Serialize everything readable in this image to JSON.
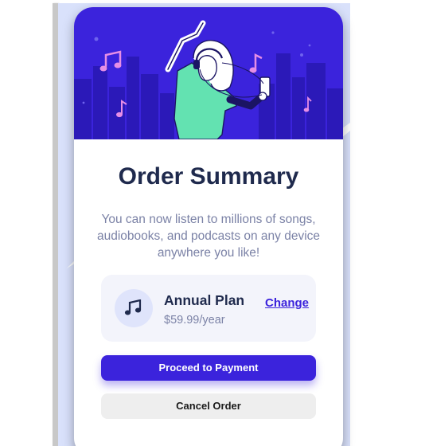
{
  "colors": {
    "accent": "#3b23dc",
    "title": "#1f2a4d",
    "muted": "#7b82a6",
    "plan_bg": "#f3f4fb",
    "page_wave": "#d9e1fb",
    "music_note": "#e68ee6",
    "character_shirt": "#63e2b1"
  },
  "hero": {
    "illustration": "dancing-person-with-headphones-city-skyline"
  },
  "summary": {
    "title": "Order Summary",
    "description": "You can now listen to millions of songs, audiobooks, and podcasts on any device anywhere you like!"
  },
  "plan": {
    "icon": "music-note-icon",
    "name": "Annual Plan",
    "price": "$59.99/year",
    "change_label": "Change"
  },
  "actions": {
    "proceed_label": "Proceed to Payment",
    "cancel_label": "Cancel Order"
  }
}
